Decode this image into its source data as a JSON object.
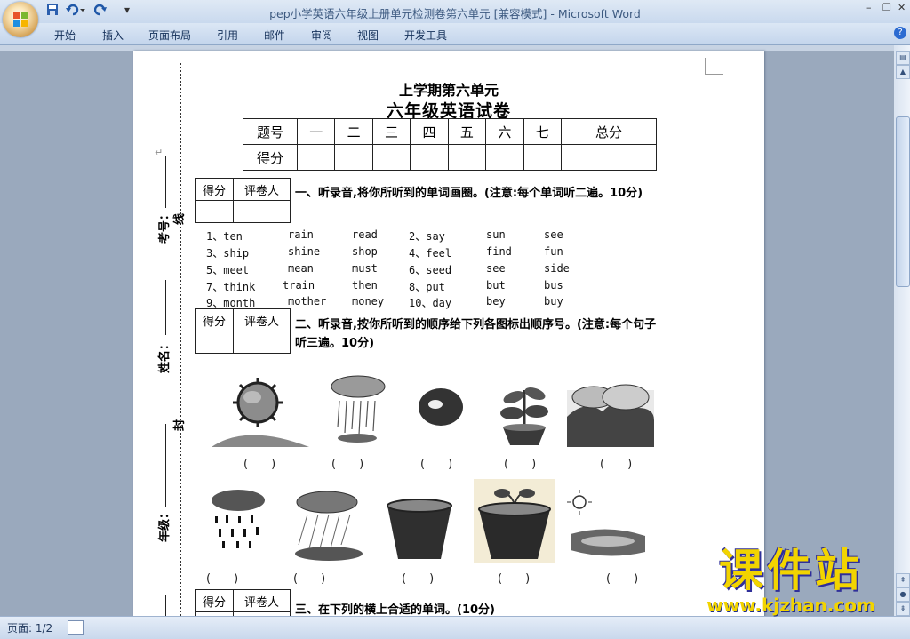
{
  "window": {
    "title": "pep小学英语六年级上册单元检测卷第六单元 [兼容模式] - Microsoft Word",
    "controls": [
      "–",
      "❐",
      "✕"
    ]
  },
  "ribbon": {
    "tabs": [
      "开始",
      "插入",
      "页面布局",
      "引用",
      "邮件",
      "审阅",
      "视图",
      "开发工具"
    ]
  },
  "document": {
    "title_line1": "上学期第六单元",
    "title_line2": "六年级英语试卷",
    "score_table": {
      "header": [
        "题号",
        "一",
        "二",
        "三",
        "四",
        "五",
        "六",
        "七",
        "总分"
      ],
      "row_label": "得分"
    },
    "grader_box": {
      "score": "得分",
      "grader": "评卷人"
    },
    "binding_labels": {
      "exam_no": "考号：",
      "name": "姓名：",
      "grade": "年级：",
      "line": "线",
      "seal": "封"
    },
    "section1": {
      "heading": "一、听录音,将你所听到的单词画圈。(注意:每个单词听二遍。10分)",
      "rows": [
        [
          "1、ten",
          "rain",
          "read",
          "2、say",
          "sun",
          "see"
        ],
        [
          "3、ship",
          "shine",
          "shop",
          "4、feel",
          "find",
          "fun"
        ],
        [
          "5、meet",
          "mean",
          "must",
          "6、seed",
          "see",
          "side"
        ],
        [
          "7、think",
          "train",
          "then",
          "8、put",
          "but",
          "bus"
        ],
        [
          "9、month",
          "mother",
          "money",
          "10、day",
          "bey",
          "buy"
        ]
      ]
    },
    "section2": {
      "heading": "二、听录音,按你所听到的顺序给下列各图标出顺序号。(注意:每个句子听三遍。10分)",
      "paren": "(　　)"
    },
    "section3": {
      "heading": "三、在下列的横上合适的单词。(10分)"
    }
  },
  "status": {
    "page": "页面: 1/2"
  },
  "watermark": {
    "big": "课件站",
    "url": "www.kjzhan.com"
  }
}
